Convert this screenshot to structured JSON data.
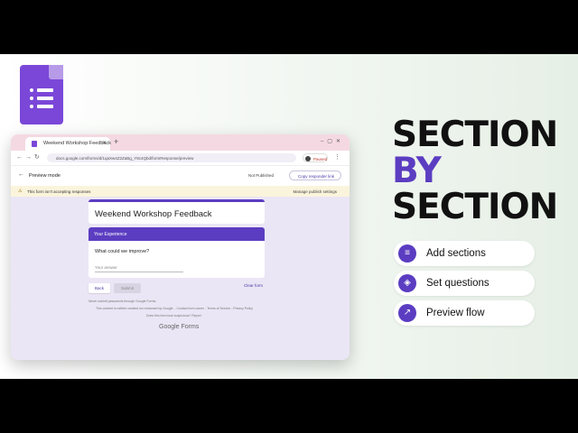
{
  "app": {
    "tab_title": "Weekend Workshop Feedback",
    "url": "docs.google.com/forms/d/1qaXw4Z2ZaBg_Y8c4Qbd/formResponse/preview",
    "profile_status": "Paused"
  },
  "toolbar": {
    "mode": "Preview mode",
    "publish_status": "Not Published",
    "copy_link": "Copy responder link"
  },
  "banner": {
    "message": "This form isn't accepting responses",
    "manage": "Manage publish settings"
  },
  "form": {
    "title": "Weekend Workshop Feedback",
    "section_title": "Your Experience",
    "question": "What could we improve?",
    "answer_placeholder": "Your answer",
    "back_label": "Back",
    "submit_label": "Submit",
    "clear_label": "Clear form",
    "fine_print_1": "Never submit passwords through Google Forms.",
    "fine_print_2": "This content is neither created nor endorsed by Google. - Contact form owner - Terms of Service - Privacy Policy",
    "fine_print_3": "Does this form look suspicious? Report",
    "brand": "Google Forms"
  },
  "headline": {
    "line1": "SECTION",
    "line2": "BY",
    "line3": "SECTION"
  },
  "features": [
    {
      "label": "Add sections",
      "icon": "list-icon"
    },
    {
      "label": "Set questions",
      "icon": "tag-icon"
    },
    {
      "label": "Preview flow",
      "icon": "trend-icon"
    }
  ],
  "colors": {
    "accent": "#5b3dc1",
    "logo": "#7b47d8",
    "banner": "#fbf4dc"
  }
}
